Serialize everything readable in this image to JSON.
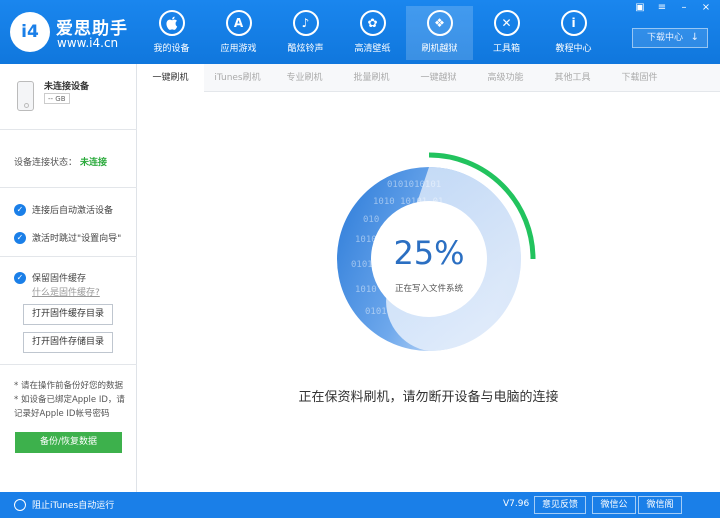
{
  "header": {
    "logo_text": "i4",
    "brand_name": "爱思助手",
    "brand_url": "www.i4.cn",
    "nav": [
      {
        "label": "我的设备",
        "icon": "apple-icon",
        "glyph": ""
      },
      {
        "label": "应用游戏",
        "icon": "appstore-icon",
        "glyph": "A"
      },
      {
        "label": "酷炫铃声",
        "icon": "bell-icon",
        "glyph": "♪"
      },
      {
        "label": "高清壁纸",
        "icon": "flower-icon",
        "glyph": "✿"
      },
      {
        "label": "刷机越狱",
        "icon": "box-icon",
        "glyph": "❖"
      },
      {
        "label": "工具箱",
        "icon": "tools-icon",
        "glyph": "✕"
      },
      {
        "label": "教程中心",
        "icon": "info-icon",
        "glyph": "i"
      }
    ],
    "download_center": "下载中心",
    "download_icon": "↓"
  },
  "sidebar": {
    "device_name": "未连接设备",
    "device_capacity": "-- GB",
    "conn_label": "设备连接状态：",
    "conn_value": "未连接",
    "options": [
      "连接后自动激活设备",
      "激活时跳过\"设置向导\"",
      "保留固件缓存"
    ],
    "firmware_cache_link": "什么是固件缓存?",
    "open_cache_dir": "打开固件缓存目录",
    "open_storage_dir": "打开固件存储目录",
    "notes": [
      "* 请在操作前备份好您的数据",
      "* 如设备已绑定Apple ID，请",
      "记录好Apple ID帐号密码"
    ],
    "backup_button": "备份/恢复数据"
  },
  "tabs": [
    "一键刷机",
    "iTunes刷机",
    "专业刷机",
    "批量刷机",
    "一键越狱",
    "高级功能",
    "其他工具",
    "下载固件"
  ],
  "main": {
    "progress_percent": "25%",
    "progress_value": 0.25,
    "ring_status": "正在写入文件系统",
    "message": "正在保资料刷机，请勿断开设备与电脑的连接",
    "colors": {
      "progress": "#22c35e",
      "ring_dark": "#2a7ad8",
      "ring_light": "#dce9fa"
    }
  },
  "footer": {
    "itunes_toggle": "阻止iTunes自动运行",
    "version": "V7.96",
    "feedback": "意见反馈",
    "wechat_public": "微信公",
    "wechat": "微信阁"
  }
}
